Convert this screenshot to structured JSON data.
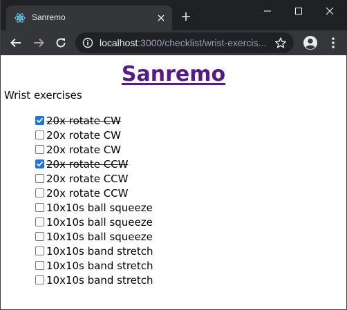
{
  "browser": {
    "tab": {
      "title": "Sanremo",
      "favicon": "react-logo-icon"
    },
    "address": {
      "host": "localhost",
      "rest": ":3000/checklist/wrist-exercis..."
    },
    "colors": {
      "titlebar": "#202124",
      "toolbar": "#35363a",
      "omnibox": "#202124"
    }
  },
  "page": {
    "site_title": "Sanremo",
    "list_title": "Wrist exercises",
    "items": [
      {
        "label": "20x rotate CW",
        "checked": true
      },
      {
        "label": "20x rotate CW",
        "checked": false
      },
      {
        "label": "20x rotate CW",
        "checked": false
      },
      {
        "label": "20x rotate CCW",
        "checked": true
      },
      {
        "label": "20x rotate CCW",
        "checked": false
      },
      {
        "label": "20x rotate CCW",
        "checked": false
      },
      {
        "label": "10x10s ball squeeze",
        "checked": false
      },
      {
        "label": "10x10s ball squeeze",
        "checked": false
      },
      {
        "label": "10x10s ball squeeze",
        "checked": false
      },
      {
        "label": "10x10s band stretch",
        "checked": false
      },
      {
        "label": "10x10s band stretch",
        "checked": false
      },
      {
        "label": "10x10s band stretch",
        "checked": false
      }
    ],
    "colors": {
      "link": "#551a8b",
      "checkbox_checked": "#1a73e8"
    }
  }
}
